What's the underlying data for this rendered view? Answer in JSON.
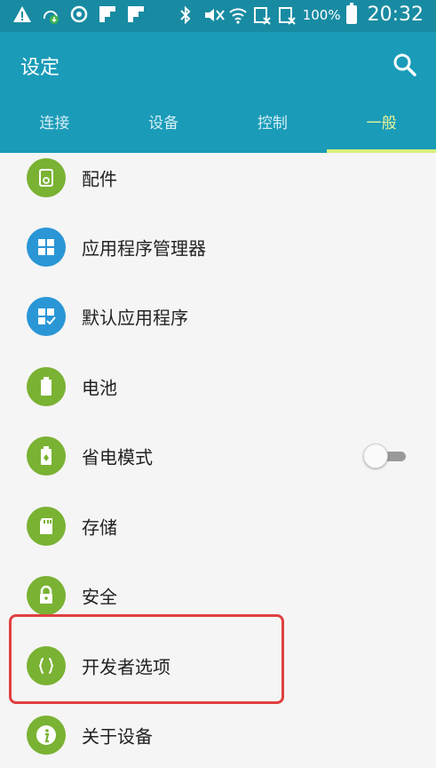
{
  "status_bar": {
    "battery": "100%",
    "time": "20:32",
    "icons": [
      "warning-icon",
      "download-icon",
      "sync-icon",
      "notification-icon",
      "notification-icon",
      "bluetooth-icon",
      "mute-icon",
      "wifi-icon",
      "no-sim-icon",
      "no-sim-icon",
      "battery-icon"
    ]
  },
  "app_bar": {
    "title": "设定",
    "tabs": [
      "连接",
      "设备",
      "控制",
      "一般"
    ],
    "active_tab": "一般"
  },
  "settings": {
    "items": [
      {
        "label": "配件",
        "icon": "accessory-icon"
      },
      {
        "label": "应用程序管理器",
        "icon": "apps-grid-icon"
      },
      {
        "label": "默认应用程序",
        "icon": "default-apps-icon"
      },
      {
        "label": "电池",
        "icon": "battery-icon"
      },
      {
        "label": "省电模式",
        "icon": "power-saving-icon",
        "toggle": false
      },
      {
        "label": "存储",
        "icon": "storage-icon"
      },
      {
        "label": "安全",
        "icon": "lock-icon"
      },
      {
        "label": "开发者选项",
        "icon": "braces-icon",
        "highlighted": true
      },
      {
        "label": "关于设备",
        "icon": "info-icon"
      }
    ]
  },
  "colors": {
    "status_bar": "#188ba2",
    "app_bar": "#1a9bb8",
    "active_tab": "#e7f59a",
    "icon_green": "#7ab233",
    "icon_blue": "#2a96d6",
    "highlight": "#e04040"
  }
}
